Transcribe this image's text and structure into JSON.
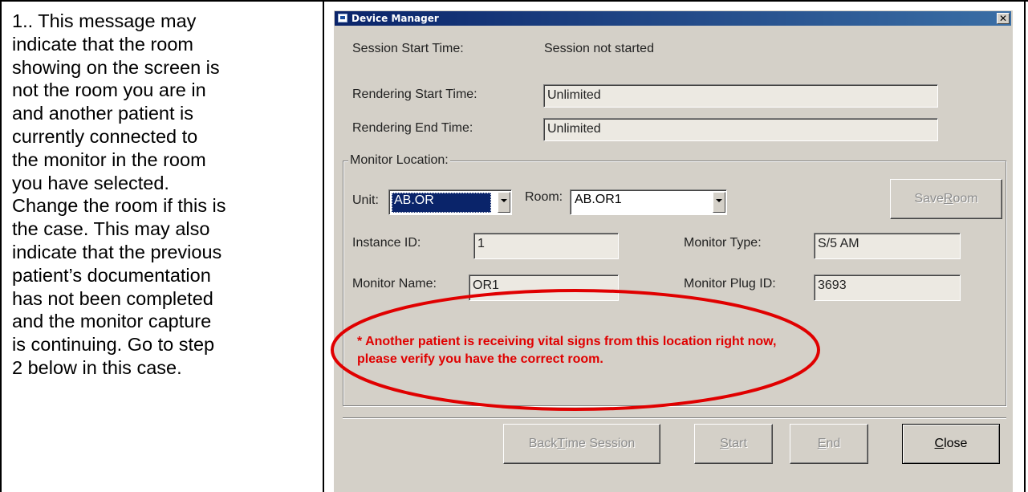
{
  "instructions": {
    "lines": [
      "1.. This message may",
      "indicate that the room",
      "showing on the screen is",
      "not the room you are in",
      "and another patient is",
      "currently connected to",
      "the monitor in the room",
      "you have selected.",
      "Change the room if this is",
      "the case. This may also",
      "indicate that the previous",
      "patient’s documentation",
      "has not been completed",
      "and the monitor capture",
      "is continuing. Go to step",
      "2 below in this case."
    ]
  },
  "dialog": {
    "title": "Device Manager",
    "close_glyph": "✕",
    "session_start_label": "Session Start Time:",
    "session_start_value": "Session not started",
    "rendering_start_label": "Rendering Start Time:",
    "rendering_start_value": "Unlimited",
    "rendering_end_label": "Rendering End Time:",
    "rendering_end_value": "Unlimited",
    "monitor_location_label": "Monitor Location:",
    "unit_label": "Unit:",
    "unit_value": "AB.OR",
    "room_label": "Room:",
    "room_value": "AB.OR1",
    "save_room_pre": "Save ",
    "save_room_key": "R",
    "save_room_post": "oom",
    "instance_id_label": "Instance ID:",
    "instance_id_value": "1",
    "monitor_type_label": "Monitor Type:",
    "monitor_type_value": "S/5 AM",
    "monitor_name_label": "Monitor Name:",
    "monitor_name_value": "OR1",
    "monitor_plug_label": "Monitor Plug ID:",
    "monitor_plug_value": "3693",
    "warning_line1": "*  Another patient is receiving vital signs from this location right now,",
    "warning_line2": "please verify you have the correct room.",
    "buttons": {
      "back_time_pre": "Back ",
      "back_time_key": "T",
      "back_time_post": "ime Session",
      "start_key": "S",
      "start_post": "tart",
      "end_key": "E",
      "end_post": "nd",
      "close_key": "C",
      "close_post": "lose"
    }
  },
  "colors": {
    "warning": "#e00000",
    "highlight_ellipse": "#e00000",
    "titlebar": "#0a246a",
    "dialog_bg": "#d4d0c8"
  }
}
